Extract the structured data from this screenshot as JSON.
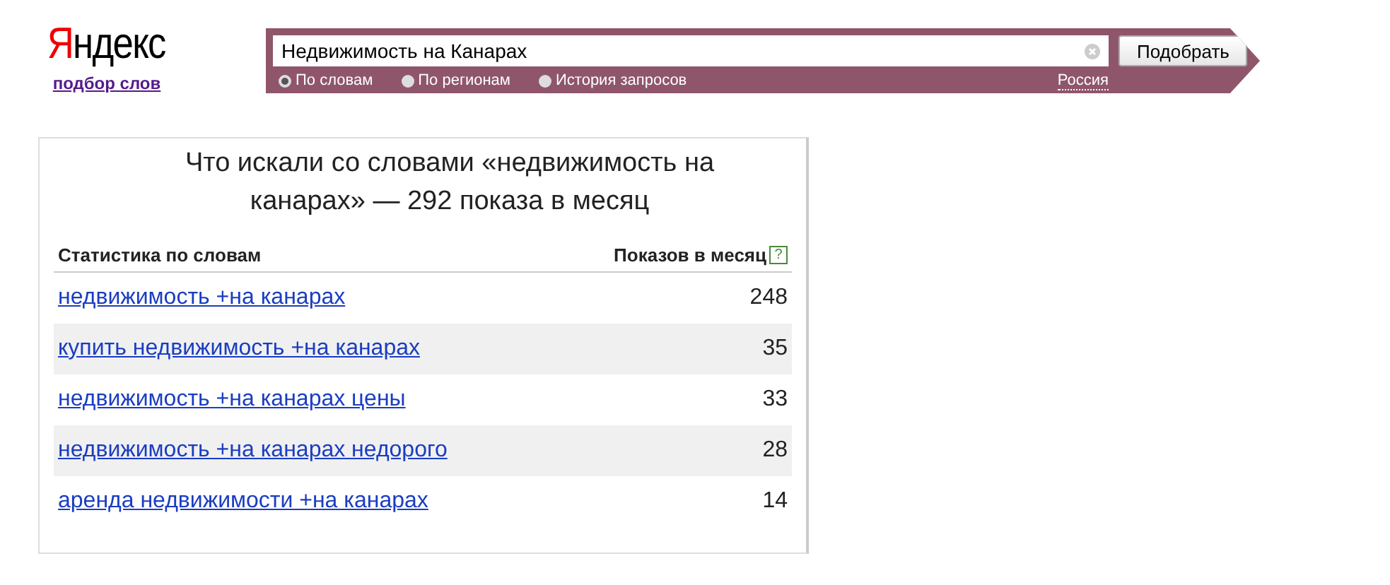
{
  "logo": {
    "text": "Яндекс",
    "subtitle": "подбор слов"
  },
  "search": {
    "value": "Недвижимость на Канарах",
    "button": "Подобрать",
    "region": "Россия",
    "modes": [
      {
        "label": "По словам",
        "selected": true
      },
      {
        "label": "По регионам",
        "selected": false
      },
      {
        "label": "История запросов",
        "selected": false
      }
    ]
  },
  "results": {
    "title": "Что искали со словами «недвижимость на канарах» — 292 показа в месяц",
    "columns": [
      "Статистика по словам",
      "Показов в месяц"
    ],
    "help": "?",
    "rows": [
      {
        "phrase": "недвижимость +на канарах",
        "count": "248"
      },
      {
        "phrase": "купить недвижимость +на канарах",
        "count": "35"
      },
      {
        "phrase": "недвижимость +на канарах цены",
        "count": "33"
      },
      {
        "phrase": "недвижимость +на канарах недорого",
        "count": "28"
      },
      {
        "phrase": "аренда недвижимости +на канарах",
        "count": "14"
      }
    ]
  }
}
